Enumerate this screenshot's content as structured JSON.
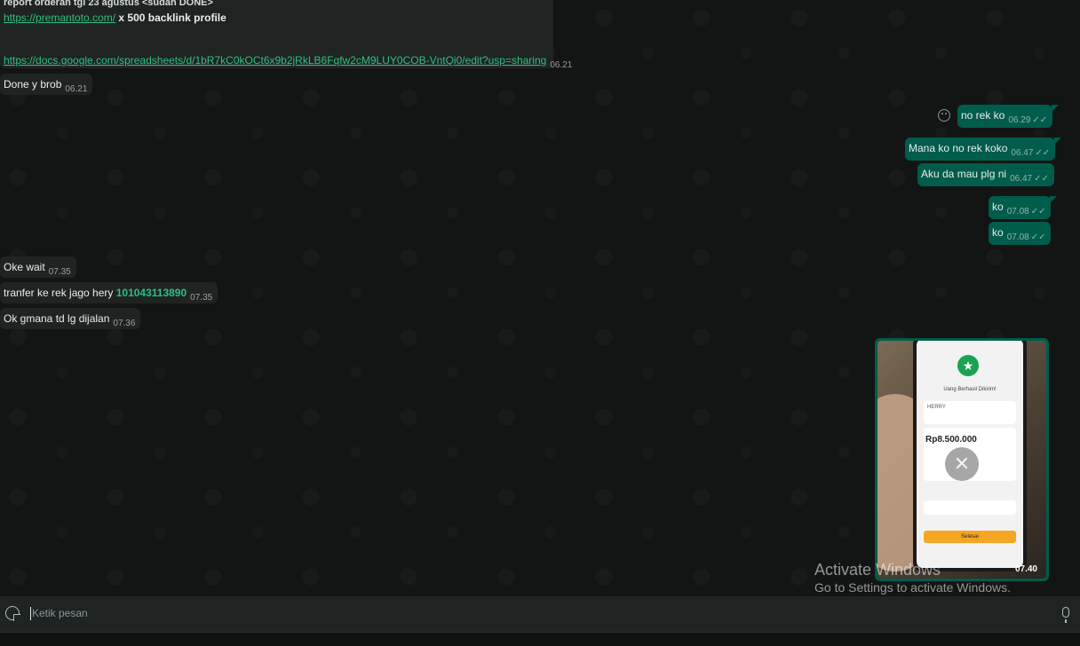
{
  "messages": {
    "cut_top_text": "report orderan tgl 23 agustus <sudah DONE>",
    "m1_link": "https://premantoto.com/",
    "m1_text": " x 500 backlink profile",
    "m1_url2": "https://docs.google.com/spreadsheets/d/1bR7kC0kOCt6x9b2jRkLB6Fqfw2cM9LUY0COB-VntQi0/edit?usp=sharing",
    "m1_time": "06.21",
    "m2_text": "Done y brob",
    "m2_time": "06.21",
    "o1_text": "no rek ko",
    "o1_time": "06.29",
    "o2_text": "Mana ko no rek koko",
    "o2_time": "06.47",
    "o3_text": "Aku da mau plg ni",
    "o3_time": "06.47",
    "o4_text": "ko",
    "o4_time": "07.08",
    "o5_text": "ko",
    "o5_time": "07.08",
    "i3_text": "Oke wait",
    "i3_time": "07.35",
    "i4_text": "tranfer ke rek jago hery ",
    "i4_number": "101043113890",
    "i4_time": "07.35",
    "i5_text": "Ok gmana td lg dijalan",
    "i5_time": "07.36",
    "ticks": "✓✓"
  },
  "media": {
    "time": "07.40",
    "screen_title": "Uang Berhasil Dikirim!",
    "recipient": "HERRY",
    "amount": "Rp8.500.000",
    "button": "Selesai"
  },
  "composer": {
    "placeholder": "Ketik pesan"
  },
  "watermark": {
    "title": "Activate Windows",
    "subtitle": "Go to Settings to activate Windows."
  }
}
